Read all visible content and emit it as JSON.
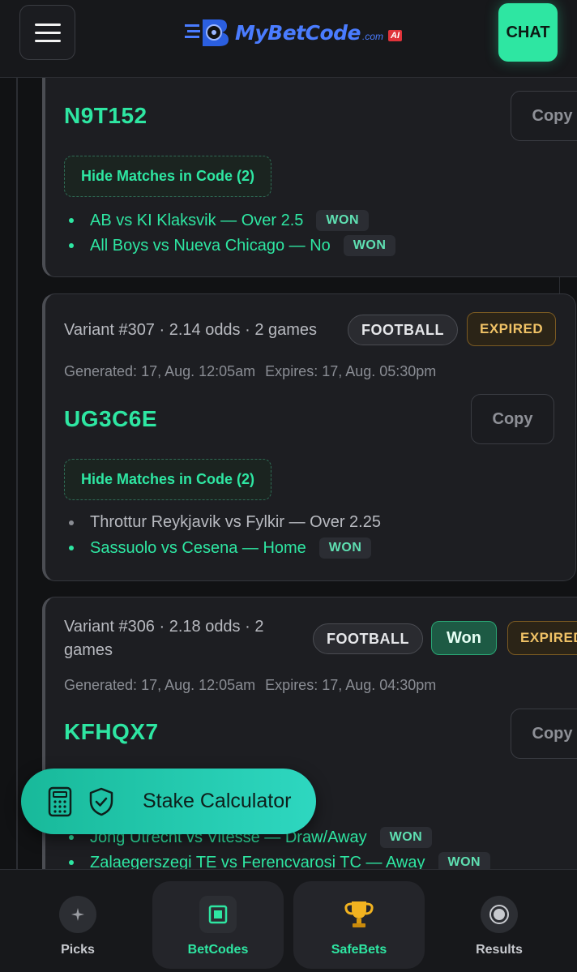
{
  "header": {
    "logo_text": "MyBetCode",
    "logo_domain": ".com",
    "logo_badge": "AI",
    "chat_label": "CHAT"
  },
  "cards": [
    {
      "code": "N9T152",
      "copy_label": "Copy",
      "hide_label": "Hide Matches in Code (2)",
      "matches": [
        {
          "text": "AB vs KI Klaksvik — Over 2.5",
          "status": "WON"
        },
        {
          "text": "All Boys vs Nueva Chicago — No",
          "status": "WON"
        }
      ]
    },
    {
      "variant": "Variant #307 · 2.14 odds · 2 games",
      "sport": "FOOTBALL",
      "state": "EXPIRED",
      "generated": "Generated: 17, Aug. 12:05am",
      "expires": "Expires: 17, Aug. 05:30pm",
      "code": "UG3C6E",
      "copy_label": "Copy",
      "hide_label": "Hide Matches in Code (2)",
      "matches": [
        {
          "text": "Throttur Reykjavik vs Fylkir — Over 2.25",
          "status": ""
        },
        {
          "text": "Sassuolo vs Cesena — Home",
          "status": "WON"
        }
      ]
    },
    {
      "variant_line1": "Variant #306 · 2.18 odds · 2",
      "variant_line2": "games",
      "sport": "FOOTBALL",
      "result": "Won",
      "state": "EXPIRED",
      "generated": "Generated: 17, Aug. 12:05am",
      "expires": "Expires: 17, Aug. 04:30pm",
      "code": "KFHQX7",
      "copy_label": "Copy",
      "matches": [
        {
          "text": "Jong Utrecht vs Vitesse — Draw/Away",
          "status": "WON"
        },
        {
          "text": "Zalaegerszegi TE vs Ferencvarosi TC — Away",
          "status": "WON"
        }
      ]
    }
  ],
  "stake_calculator": {
    "label": "Stake Calculator"
  },
  "bottom_nav": [
    {
      "label": "Picks",
      "icon": "sparkle-icon"
    },
    {
      "label": "BetCodes",
      "icon": "square-icon"
    },
    {
      "label": "SafeBets",
      "icon": "trophy-icon"
    },
    {
      "label": "Results",
      "icon": "record-icon"
    }
  ],
  "colors": {
    "accent": "#2ee6a2",
    "expired": "#f0c266",
    "won_bg": "#1d5a44"
  }
}
